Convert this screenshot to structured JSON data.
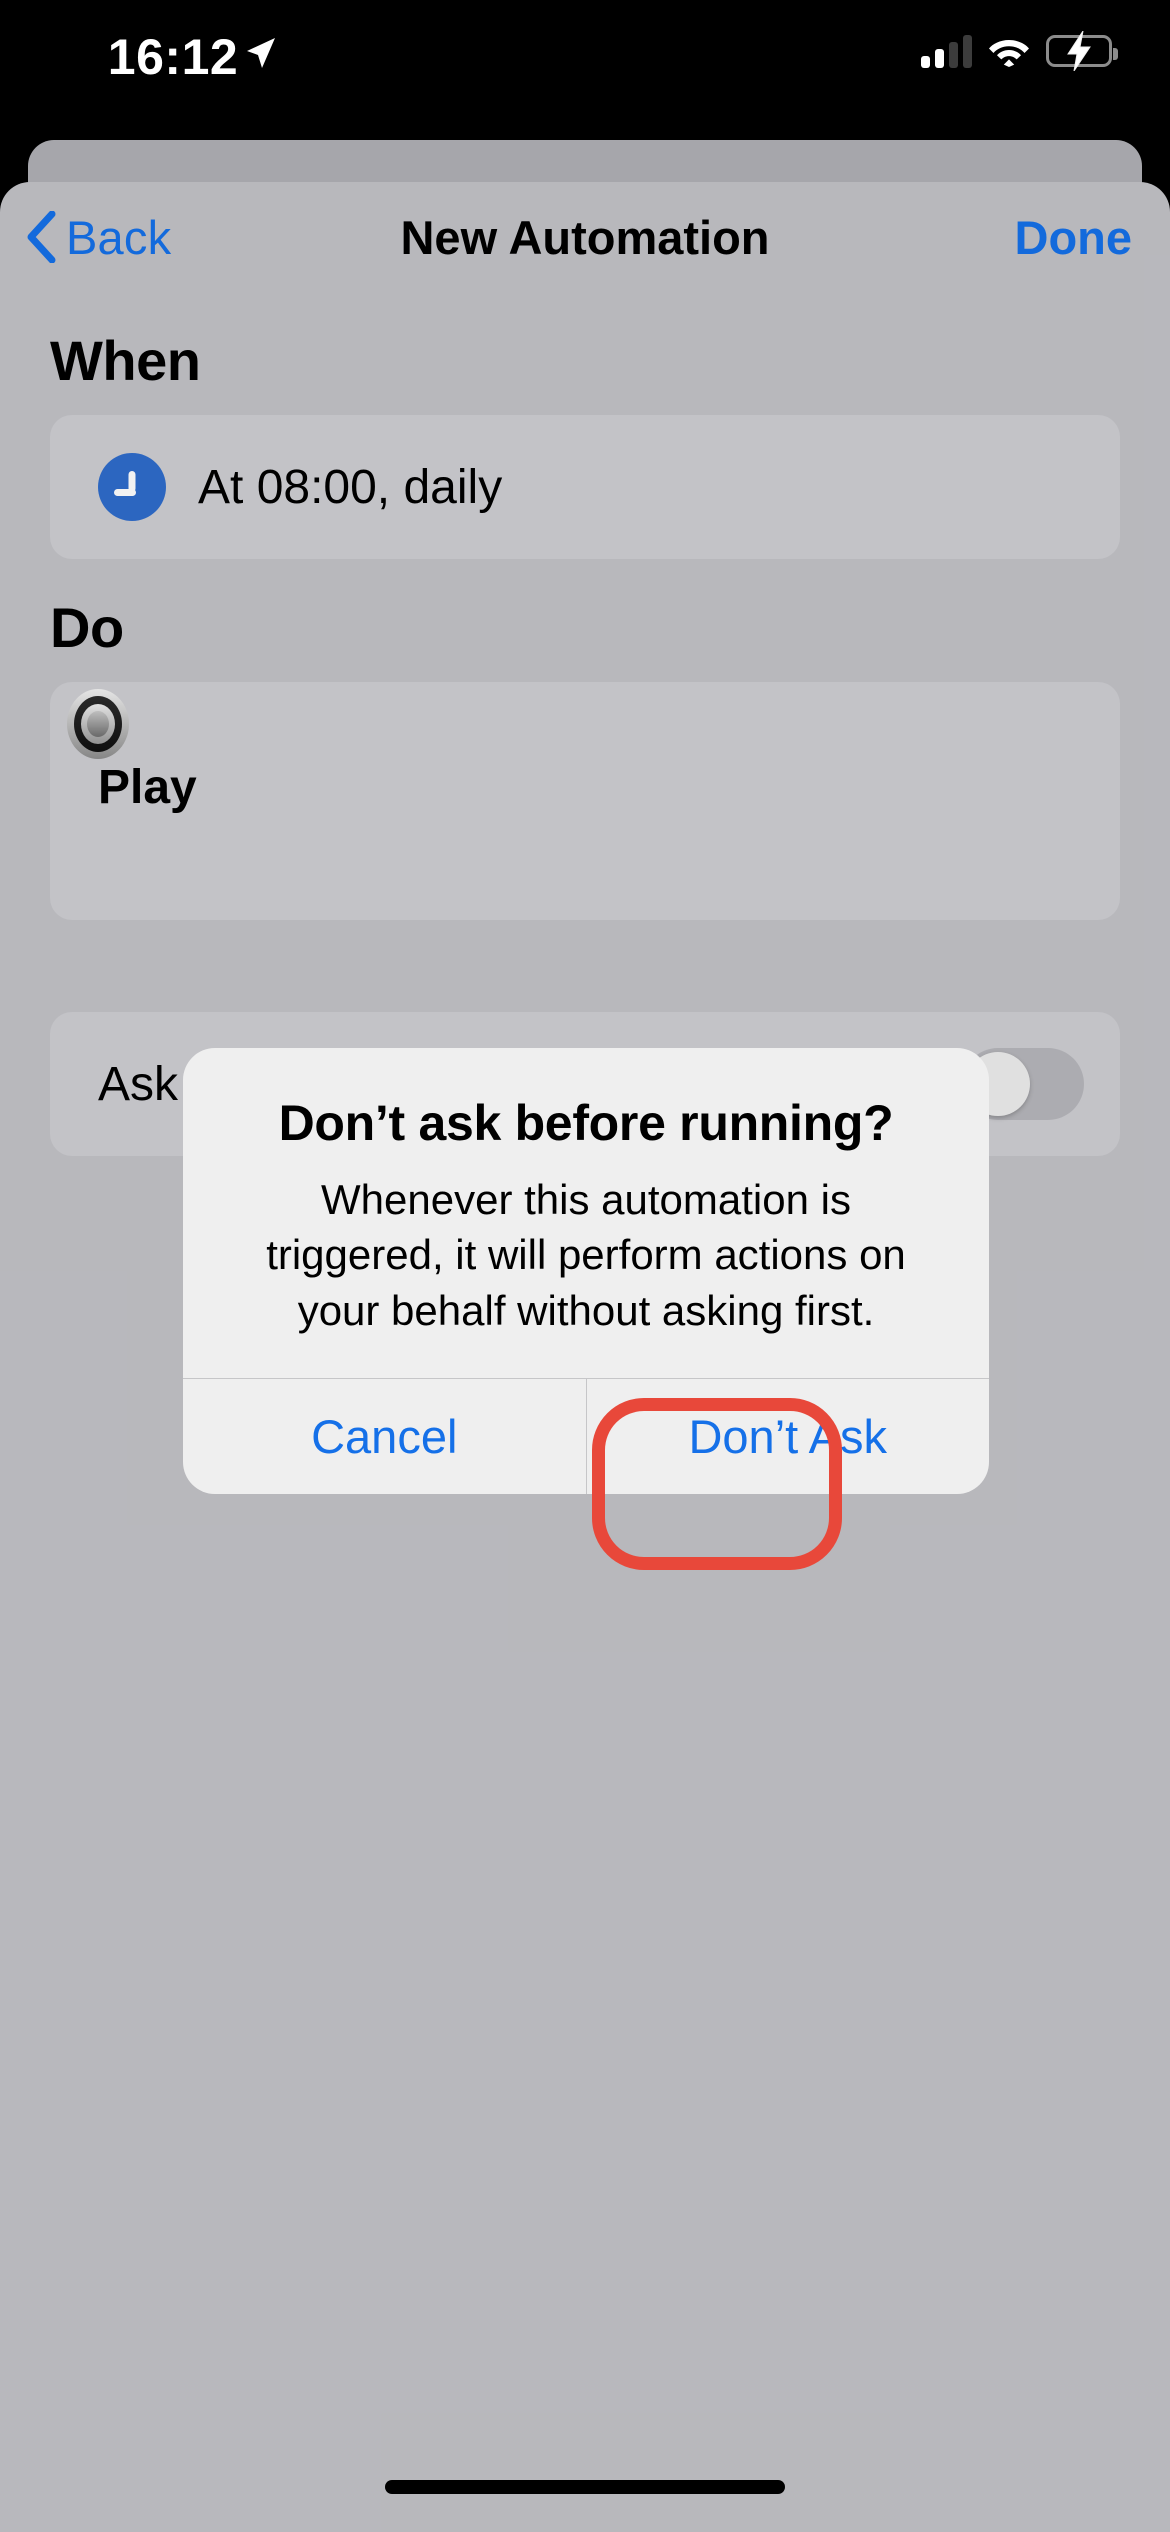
{
  "status_bar": {
    "time": "16:12",
    "location_icon": "location-arrow-icon",
    "cellular_icon": "cellular-signal-icon",
    "cellular_bars_filled": 2,
    "cellular_bars_total": 4,
    "wifi_icon": "wifi-icon",
    "battery_icon": "battery-charging-icon",
    "battery_color": "#4CD667",
    "charging": true
  },
  "navbar": {
    "back_label": "Back",
    "back_icon": "chevron-left-icon",
    "title": "New Automation",
    "done_label": "Done"
  },
  "sections": {
    "when": {
      "heading": "When",
      "trigger": {
        "icon": "clock-icon",
        "icon_color": "#2F6CCB",
        "text": "At 08:00, daily"
      }
    },
    "do": {
      "heading": "Do",
      "action": {
        "icon": "speaker-app-icon",
        "title": "Play"
      }
    },
    "ask": {
      "label": "Ask",
      "toggle_state": "off"
    }
  },
  "alert": {
    "title": "Don’t ask before running?",
    "message": "Whenever this automation is triggered, it will perform actions on your behalf without asking first.",
    "buttons": [
      {
        "label": "Cancel",
        "name": "cancel-button"
      },
      {
        "label": "Don’t Ask",
        "name": "dont-ask-button"
      }
    ],
    "highlight_color": "#E8483A",
    "highlighted_button": "Don’t Ask"
  },
  "colors": {
    "accent_blue": "#1570E8",
    "sheet_background": "#C2C2C7",
    "card_background": "#CECED2",
    "alert_background": "#EFEFEF"
  },
  "home_indicator": "home-indicator"
}
